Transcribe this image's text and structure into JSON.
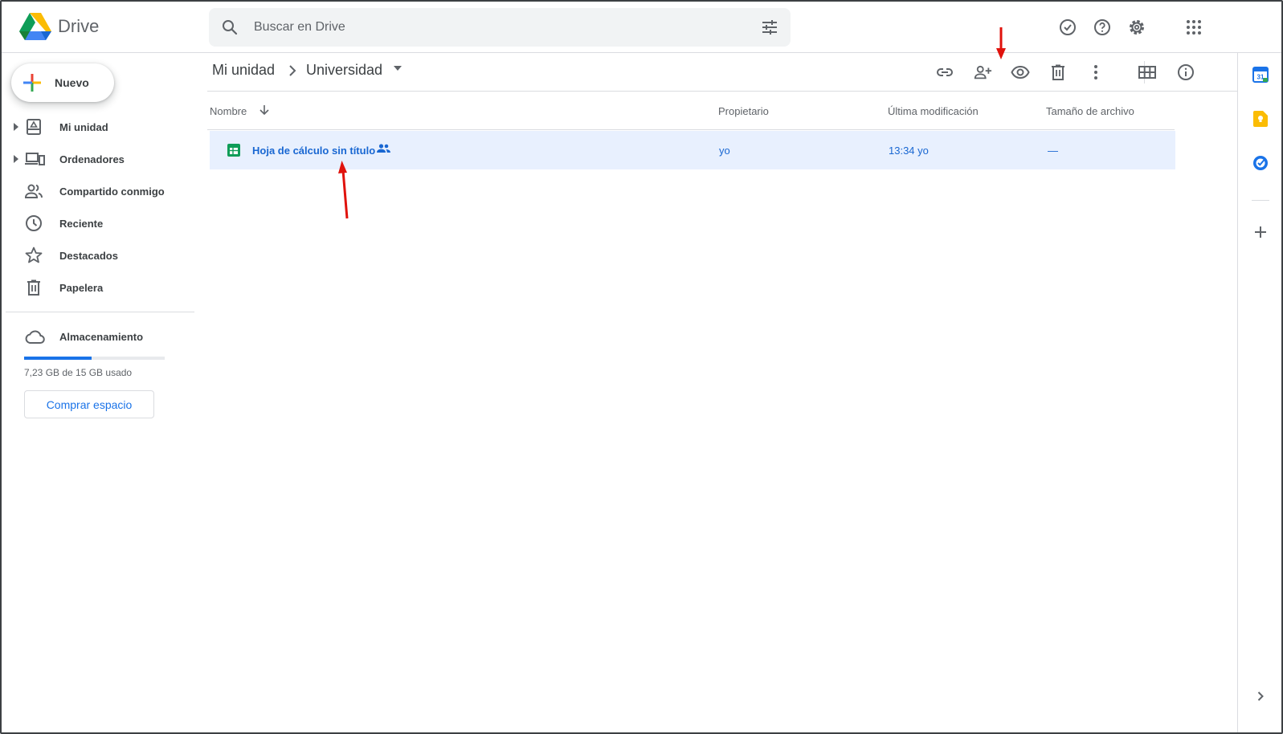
{
  "app": {
    "name": "Drive",
    "search": {
      "placeholder": "Buscar en Drive",
      "value": ""
    }
  },
  "top_icons": [
    "ready-for-offline-icon",
    "help-icon",
    "settings-icon",
    "apps-grid-icon"
  ],
  "sidebar": {
    "new_label": "Nuevo",
    "items": [
      {
        "label": "Mi unidad",
        "icon": "my-drive-icon",
        "expandable": true
      },
      {
        "label": "Ordenadores",
        "icon": "computers-icon",
        "expandable": true
      },
      {
        "label": "Compartido conmigo",
        "icon": "shared-with-me-icon",
        "expandable": false
      },
      {
        "label": "Reciente",
        "icon": "clock-icon",
        "expandable": false
      },
      {
        "label": "Destacados",
        "icon": "star-icon",
        "expandable": false
      },
      {
        "label": "Papelera",
        "icon": "trash-icon",
        "expandable": false
      }
    ],
    "storage": {
      "label": "Almacenamiento",
      "usage_text": "7,23 GB de 15 GB usado",
      "used_fraction": 0.482,
      "buy_label": "Comprar espacio"
    }
  },
  "breadcrumb": {
    "root": "Mi unidad",
    "current": "Universidad"
  },
  "toolbar_icons": [
    "link-icon",
    "share-icon",
    "preview-icon",
    "delete-icon",
    "more-icon",
    "grid-view-icon",
    "info-icon"
  ],
  "table": {
    "columns": [
      "Nombre",
      "Propietario",
      "Última modificación",
      "Tamaño de archivo"
    ],
    "rows": [
      {
        "name": "Hoja de cálculo sin título",
        "owner": "yo",
        "modified": "13:34 yo",
        "size": "—",
        "type": "spreadsheet",
        "shared": true
      }
    ]
  },
  "side_panel_icons": [
    "calendar-icon",
    "keep-icon",
    "tasks-icon",
    "add-icon",
    "expand-icon"
  ],
  "colors": {
    "accent": "#1a73e8",
    "selected_row": "#e8f0fe",
    "annotation": "#e0120c"
  }
}
